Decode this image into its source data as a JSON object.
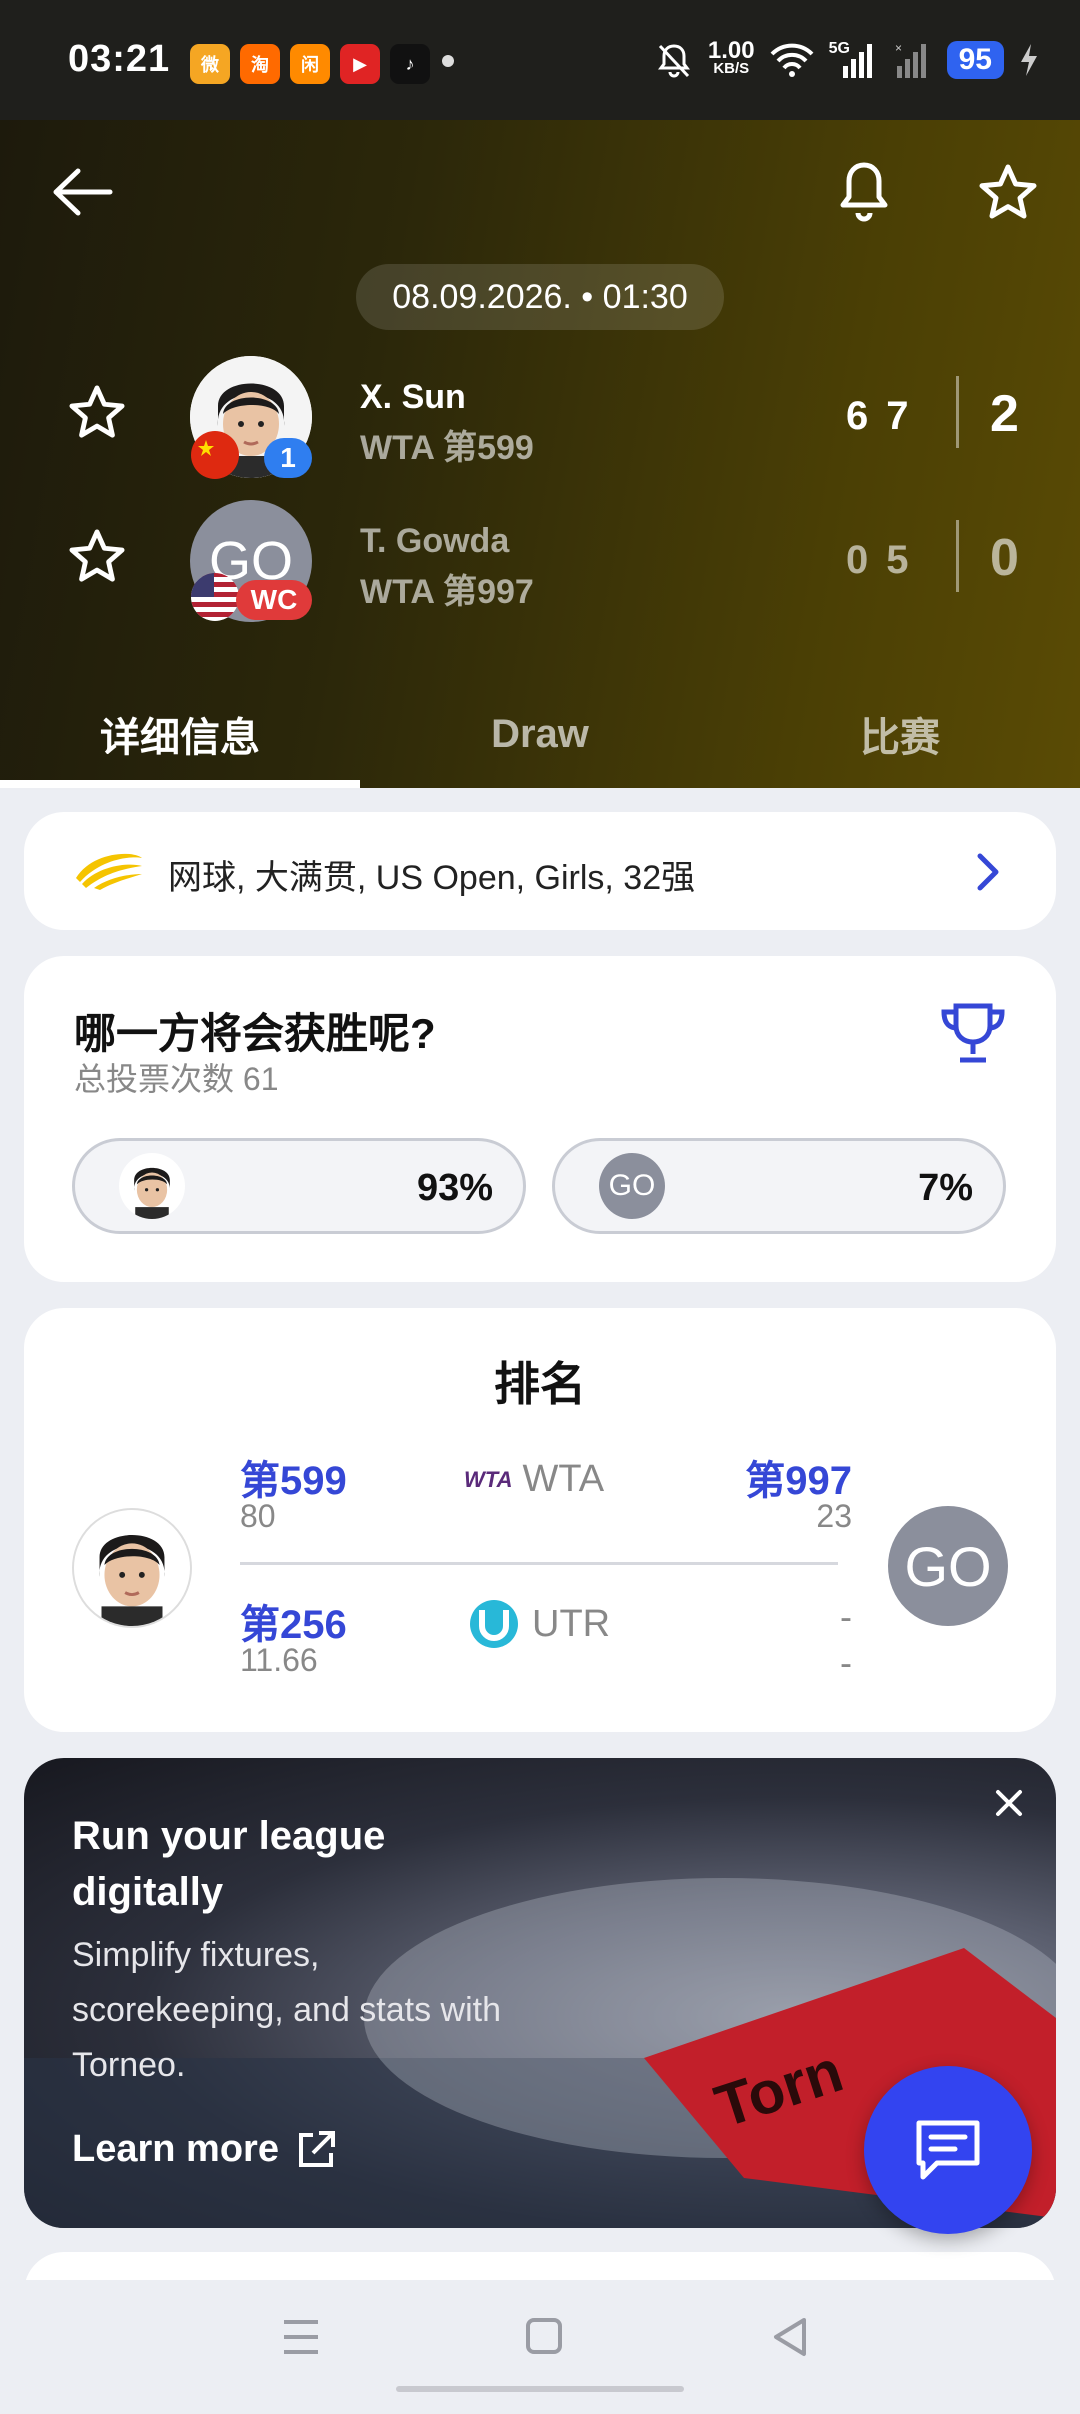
{
  "status_bar": {
    "time": "03:21",
    "apps": [
      {
        "name": "weibo-app-icon",
        "color": "#f5a623",
        "glyph": "微"
      },
      {
        "name": "taobao-app-icon",
        "color": "#ff6a00",
        "glyph": "淘"
      },
      {
        "name": "xianyu-app-icon",
        "color": "#ff8a00",
        "glyph": "闲"
      },
      {
        "name": "video-app-icon",
        "color": "#e02424",
        "glyph": "▶"
      },
      {
        "name": "tiktok-app-icon",
        "color": "#111111",
        "glyph": "♪"
      }
    ],
    "net_speed_value": "1.00",
    "net_speed_unit": "KB/S",
    "network": "5G",
    "battery": "95"
  },
  "match": {
    "datetime": "08.09.2026. • 01:30",
    "players": [
      {
        "name": "X. Sun",
        "rank": "WTA 第599",
        "seed_badge": "1",
        "flag": "china-flag-icon",
        "sets": [
          "6",
          "7"
        ],
        "score": "2"
      },
      {
        "name": "T. Gowda",
        "rank": "WTA 第997",
        "initials": "GO",
        "badge": "WC",
        "flag": "usa-flag-icon",
        "sets": [
          "0",
          "5"
        ],
        "score": "0"
      }
    ],
    "tabs": [
      "详细信息",
      "Draw",
      "比赛"
    ],
    "active_tab": 0
  },
  "breadcrumb": {
    "text": "网球, 大满贯, US Open, Girls, 32强"
  },
  "vote": {
    "title": "哪一方将会获胜呢?",
    "subtitle": "总投票次数 61",
    "home_pct": "93%",
    "away_initials": "GO",
    "away_pct": "7%"
  },
  "rankings": {
    "title": "排名",
    "rows": [
      {
        "label": "WTA",
        "home_rank": "第599",
        "home_points": "80",
        "away_rank": "第997",
        "away_points": "23"
      },
      {
        "label": "UTR",
        "home_rank": "第256",
        "home_points": "11.66",
        "away_rank": "-",
        "away_points": "-"
      }
    ],
    "away_initials": "GO",
    "wta_logo_text": "WTA"
  },
  "ad": {
    "headline_1": "Run your league",
    "headline_2": "digitally",
    "body": "Simplify fixtures, scorekeeping, and stats with Torneo.",
    "cta": "Learn more"
  },
  "colors": {
    "accent_blue": "#3547d6",
    "fab_blue": "#3344f0",
    "badge_red": "#e03a3a",
    "badge_blue": "#2f7ef0"
  }
}
